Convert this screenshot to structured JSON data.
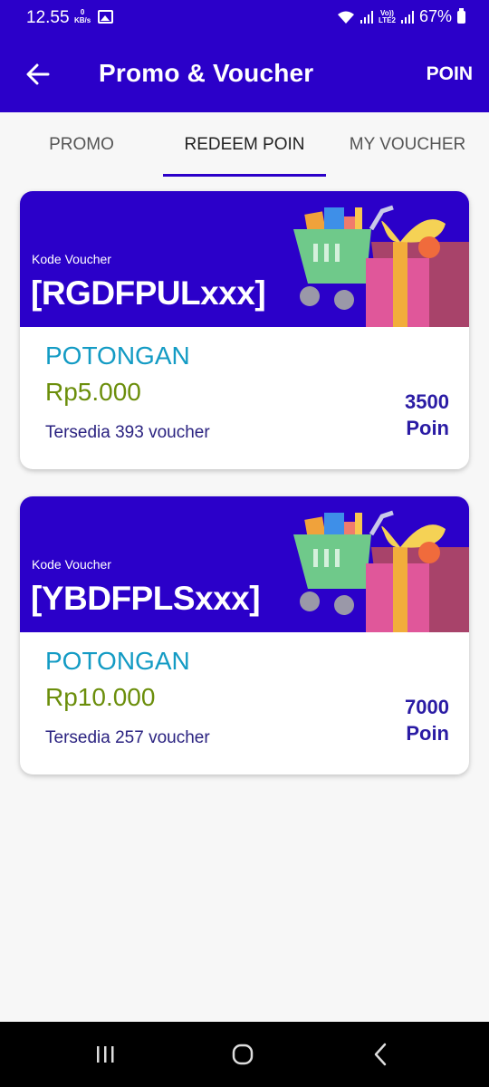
{
  "status_bar": {
    "time": "12.55",
    "net_speed_value": "0",
    "net_speed_unit": "KB/s",
    "volte_top": "Vo))",
    "volte_bottom": "LTE2",
    "battery": "67%"
  },
  "app_bar": {
    "title": "Promo & Voucher",
    "action_label": "POIN"
  },
  "tabs": [
    {
      "label": "PROMO",
      "active": false
    },
    {
      "label": "REDEEM POIN",
      "active": true
    },
    {
      "label": "MY VOUCHER",
      "active": false
    }
  ],
  "vouchers": [
    {
      "kode_label": "Kode Voucher",
      "code": "[RGDFPULxxx]",
      "type": "POTONGAN",
      "amount": "Rp5.000",
      "availability": "Tersedia 393 voucher",
      "points": "3500",
      "points_unit": "Poin"
    },
    {
      "kode_label": "Kode Voucher",
      "code": "[YBDFPLSxxx]",
      "type": "POTONGAN",
      "amount": "Rp10.000",
      "availability": "Tersedia 257 voucher",
      "points": "7000",
      "points_unit": "Poin"
    }
  ],
  "colors": {
    "brand": "#2b00c9",
    "potongan": "#139bc4",
    "amount": "#6b8e0b",
    "points": "#2a1ba4"
  },
  "icons": {
    "back": "arrow-left-icon",
    "recents": "recents-icon",
    "home": "home-icon",
    "back_nav": "chevron-left-icon"
  }
}
